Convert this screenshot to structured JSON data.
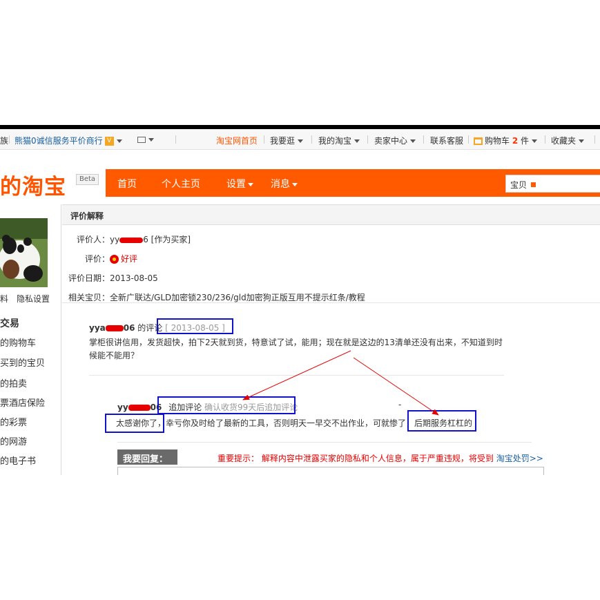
{
  "topbar": {
    "left_fragment": "族",
    "panda_service": "熊猫0诚信服务平价商行",
    "v_badge": "V",
    "links": [
      {
        "label": "淘宝网首页"
      },
      {
        "label": "我要逛"
      },
      {
        "label": "我的淘宝"
      },
      {
        "label": "卖家中心"
      },
      {
        "label": "联系客服"
      },
      {
        "label": "购物车"
      },
      {
        "label": "收藏夹"
      }
    ],
    "cart_count": "2",
    "cart_unit": "件"
  },
  "header": {
    "logo": "的淘宝",
    "beta": "Beta",
    "nav": [
      "首页",
      "个人主页",
      "设置",
      "消息"
    ],
    "search_label": "宝贝"
  },
  "sidebar": {
    "profile_links": "料　隐私设置",
    "section": "交易",
    "items": [
      "的购物车",
      "买到的宝贝",
      "的拍卖",
      "票酒店保险",
      "的彩票",
      "的网游",
      "的电子书"
    ]
  },
  "review": {
    "panel_title": "评价解释",
    "reviewer_label": "评价人：",
    "reviewer_prefix": "yy",
    "reviewer_suffix": "6 [作为买家]",
    "rating_label": "评价：",
    "rating_value": "好评",
    "date_label": "评价日期：",
    "date_value": "2013-08-05",
    "item_label": "相关宝贝：",
    "item_value": "全新广联达/GLD加密锁230/236/gld加密狗正版互用不提示红条/教程"
  },
  "comment": {
    "name_prefix": "yya",
    "name_suffix": "06",
    "suffix_text": "的评论",
    "date": "[ 2013-08-05 ]",
    "text": "掌柜很讲信用，发货超快，拍下2天就到货，特意试了试，能用；现在就是这边的13清单还没有出来，不知道到时候能不能用？"
  },
  "followup": {
    "name_prefix": "yy",
    "name_suffix": "06",
    "label": "追加评论",
    "note": "确认收货99天后追加评论",
    "dash": "-",
    "text_part1": "太感谢你了，",
    "text_part2": "幸亏你及时给了最新的工具，否则明天一早交不出作业，可就惨了，",
    "text_part3": "后期服务杠杠的"
  },
  "reply": {
    "title": "我要回复：",
    "warning_prefix": "重要提示：",
    "warning_text": "解释内容中泄露买家的隐私和个人信息，属于严重违规，将受到",
    "warning_link": "淘宝处罚>>"
  },
  "colors": {
    "brand_orange": "#ff5a00",
    "annotation_blue": "#1111cc",
    "annotation_red": "#e60000"
  }
}
